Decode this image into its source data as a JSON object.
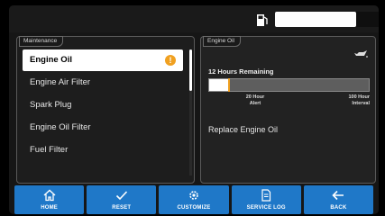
{
  "status": {
    "fuel_icon": "fuel-pump-icon"
  },
  "maintenance": {
    "panel_title": "Maintenance",
    "items": [
      {
        "label": "Engine Oil",
        "selected": true,
        "alert": "!"
      },
      {
        "label": "Engine Air Filter"
      },
      {
        "label": "Spark Plug"
      },
      {
        "label": "Engine Oil Filter"
      },
      {
        "label": "Fuel Filter"
      }
    ]
  },
  "detail": {
    "panel_title": "Engine Oil",
    "icon": "oil-can-icon",
    "remaining": "12 Hours Remaining",
    "progress_fraction": 0.88,
    "alert_marker_fraction": 0.2,
    "alert_label_line1": "20 Hour",
    "alert_label_line2": "Alert",
    "interval_label_line1": "100 Hour",
    "interval_label_line2": "Interval",
    "action": "Replace Engine Oil"
  },
  "nav": {
    "home": "HOME",
    "reset": "RESET",
    "customize": "CUSTOMIZE",
    "service_log": "SERVICE LOG",
    "back": "BACK"
  },
  "colors": {
    "accent": "#1f78c8",
    "alert": "#f0a020"
  }
}
